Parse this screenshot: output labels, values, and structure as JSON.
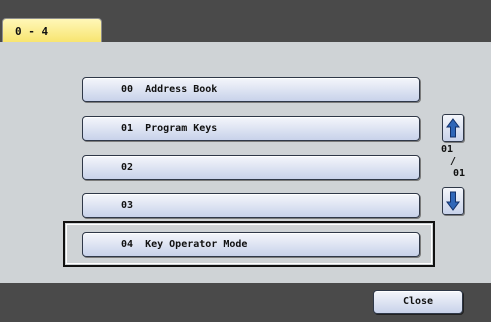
{
  "tab": {
    "label": "0 - 4"
  },
  "menu": {
    "items": [
      {
        "label": "00  Address Book"
      },
      {
        "label": "01  Program Keys"
      },
      {
        "label": "02"
      },
      {
        "label": "03"
      },
      {
        "label": "04  Key Operator Mode"
      }
    ],
    "selected_index": 4
  },
  "pagination": {
    "current": "01",
    "separator": "/",
    "total": "01"
  },
  "scroll": {
    "up_icon": "arrow-up-icon",
    "down_icon": "arrow-down-icon"
  },
  "footer": {
    "close_label": "Close"
  },
  "colors": {
    "bar": "#4a4a4a",
    "content_bg": "#cfd3d6",
    "tab": "#f7e36a",
    "button_top": "#f4f6fb",
    "button_bottom": "#c8d2ea",
    "arrow": "#2f66b8"
  }
}
